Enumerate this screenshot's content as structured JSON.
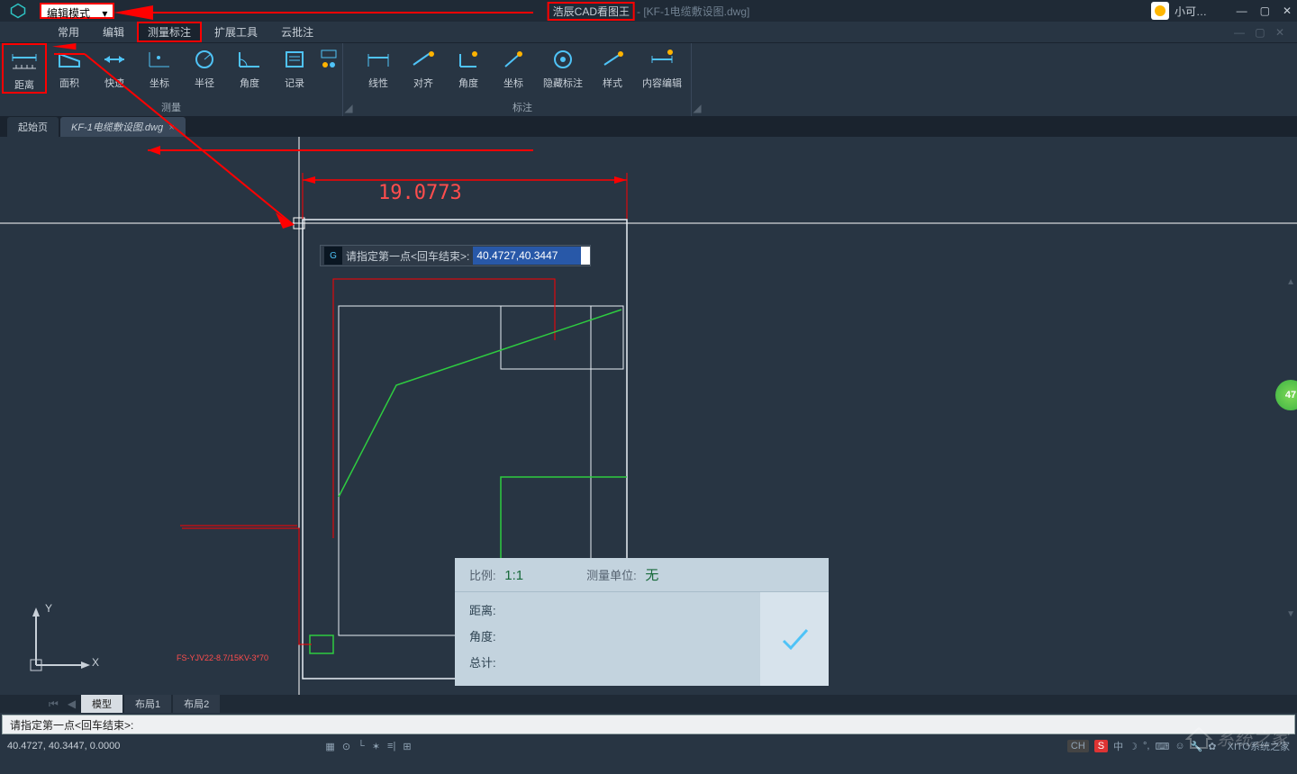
{
  "titlebar": {
    "mode_label": "编辑模式",
    "app_name": "浩辰CAD看图王",
    "file_suffix": " - [KF-1电缆敷设图.dwg]",
    "user": "小可…"
  },
  "menu": {
    "items": [
      "常用",
      "编辑",
      "测量标注",
      "扩展工具",
      "云批注"
    ],
    "active_index": 2
  },
  "ribbon": {
    "measure_group": "测量",
    "measure_items": [
      "距离",
      "面积",
      "快速",
      "坐标",
      "半径",
      "角度",
      "记录"
    ],
    "annotate_group": "标注",
    "annotate_items": [
      "线性",
      "对齐",
      "角度",
      "坐标",
      "隐藏标注",
      "样式",
      "内容编辑"
    ]
  },
  "doc_tabs": {
    "items": [
      "起始页",
      "KF-1电缆敷设图.dwg"
    ],
    "active_index": 1
  },
  "canvas": {
    "dim_value": "19.0773",
    "cable_label": "FS-YJV22-8.7/15KV-3*70",
    "ucs_x": "X",
    "ucs_y": "Y",
    "side_badge": "47"
  },
  "prompt": {
    "text": "请指定第一点<回车结束>:",
    "input_value": "40.4727,40.3447"
  },
  "result": {
    "scale_k": "比例:",
    "scale_v": "1:1",
    "unit_k": "测量单位:",
    "unit_v": "无",
    "row_distance": "距离:",
    "row_angle": "角度:",
    "row_total": "总计:"
  },
  "bottom_tabs": {
    "items": [
      "模型",
      "布局1",
      "布局2"
    ],
    "active_index": 0
  },
  "cmdline": "请指定第一点<回车结束>:",
  "statusbar": {
    "coords": "40.4727, 40.3447, 0.0000",
    "ime1": "CH",
    "ime2": "S",
    "ime3": "中",
    "right_text": "XITO系统之家"
  }
}
